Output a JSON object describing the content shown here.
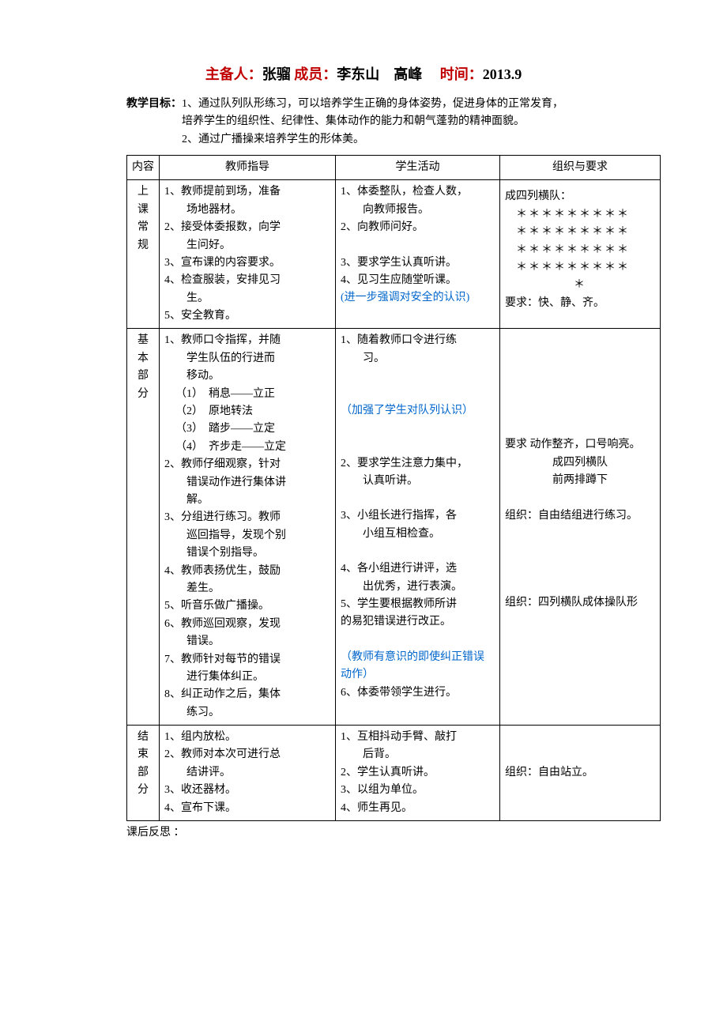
{
  "title": {
    "prep_label": "主备人：",
    "prep_name": "张骝",
    "member_label": "成员：",
    "member_names": "李东山　高峰",
    "time_label": "时间：",
    "time_value": "2013.9"
  },
  "goal": {
    "label": "教学目标：",
    "line1": "1、通过队列队形练习，可以培养学生正确的身体姿势，促进身体的正常发育，",
    "line1b": "培养学生的组织性、纪律性、集体动作的能力和朝气蓬勃的精神面貌。",
    "line2": "2、通过广播操来培养学生的形体美。"
  },
  "table": {
    "hdr_section": "内容",
    "hdr_teacher": "教师指导",
    "hdr_student": "学生活动",
    "hdr_org": "组织与要求",
    "row1": {
      "label": [
        "上",
        "课",
        "常",
        "规"
      ],
      "teacher": {
        "l1": "1、教师提前到场，准备",
        "l1b": "场地器材。",
        "l2": "2、接受体委报数，向学",
        "l2b": "生问好。",
        "l3": "3、宣布课的内容要求。",
        "l4": "4、检查服装，安排见习",
        "l4b": "生。",
        "l5": "5、安全教育。"
      },
      "student": {
        "l1": "1、体委整队，检查人数，",
        "l1b": "向教师报告。",
        "l2": "2、向教师问好。",
        "l3": "3、要求学生认真听讲。",
        "l4": "4、见习生应随堂听课。",
        "note": "(进一步强调对安全的认识)"
      },
      "org": {
        "l1": "成四列横队：",
        "stars1": "＊＊＊＊＊＊＊＊＊",
        "stars2": "＊＊＊＊＊＊＊＊＊",
        "stars3": "＊＊＊＊＊＊＊＊＊",
        "stars4": "＊＊＊＊＊＊＊＊＊",
        "stars5": "＊",
        "req": "要求：快、静、齐。"
      }
    },
    "row2": {
      "label": [
        "基",
        "本",
        "部",
        "分"
      ],
      "teacher": {
        "l1": "1、教师口令指挥，并随",
        "l1b": "学生队伍的行进而",
        "l1c": "移动。",
        "s1": "（1）　稍息——立正",
        "s2": "（2）　原地转法",
        "s3": "（3）　踏步——立定",
        "s4": "（4）　齐步走——立定",
        "l2": "2、教师仔细观察，针对",
        "l2b": "错误动作进行集体讲",
        "l2c": "解。",
        "l3": "3、分组进行练习。教师",
        "l3b": "巡回指导，发现个别",
        "l3c": "错误个别指导。",
        "l4": "4、教师表扬优生，鼓励",
        "l4b": "差生。",
        "l5": "5、听音乐做广播操。",
        "l6": "6、教师巡回观察，发现",
        "l6b": "错误。",
        "l7": "7、教师针对每节的错误",
        "l7b": "进行集体纠正。",
        "l8": "8、纠正动作之后，集体",
        "l8b": "练习。"
      },
      "student": {
        "l1": "1、随着教师口令进行练",
        "l1b": "习。",
        "note1": "（加强了学生对队列认识）",
        "l2": "2、要求学生注意力集中，",
        "l2b": "认真听讲。",
        "l3": "3、小组长进行指挥，各",
        "l3b": "小组互相检查。",
        "l4": "4、各小组进行讲评，选",
        "l4b": "出优秀，进行表演。",
        "l5": "5、学生要根据教师所讲",
        "l5b": "的易犯错误进行改正。",
        "note2": "（教师有意识的即使纠正错误动作）",
        "l6": "6、体委带领学生进行。"
      },
      "org": {
        "req1": "要求 动作整齐，口号响亮。",
        "req1b": "成四列横队",
        "req1c": "前两排蹲下",
        "org1": "组织：自由结组进行练习。",
        "org2": "组织：四列横队成体操队形"
      }
    },
    "row3": {
      "label": [
        "结",
        "束",
        "部",
        "分"
      ],
      "teacher": {
        "l1": "1、组内放松。",
        "l2": "2、教师对本次可进行总",
        "l2b": "结讲评。",
        "l3": "3、收还器材。",
        "l4": "4、宣布下课。"
      },
      "student": {
        "l1": "1、互相抖动手臂、敲打",
        "l1b": "后背。",
        "l2": "2、学生认真听讲。",
        "l3": "3、以组为单位。",
        "l4": "4、师生再见。"
      },
      "org": {
        "l1": "组织：自由站立。"
      }
    }
  },
  "after": "课后反思 ："
}
